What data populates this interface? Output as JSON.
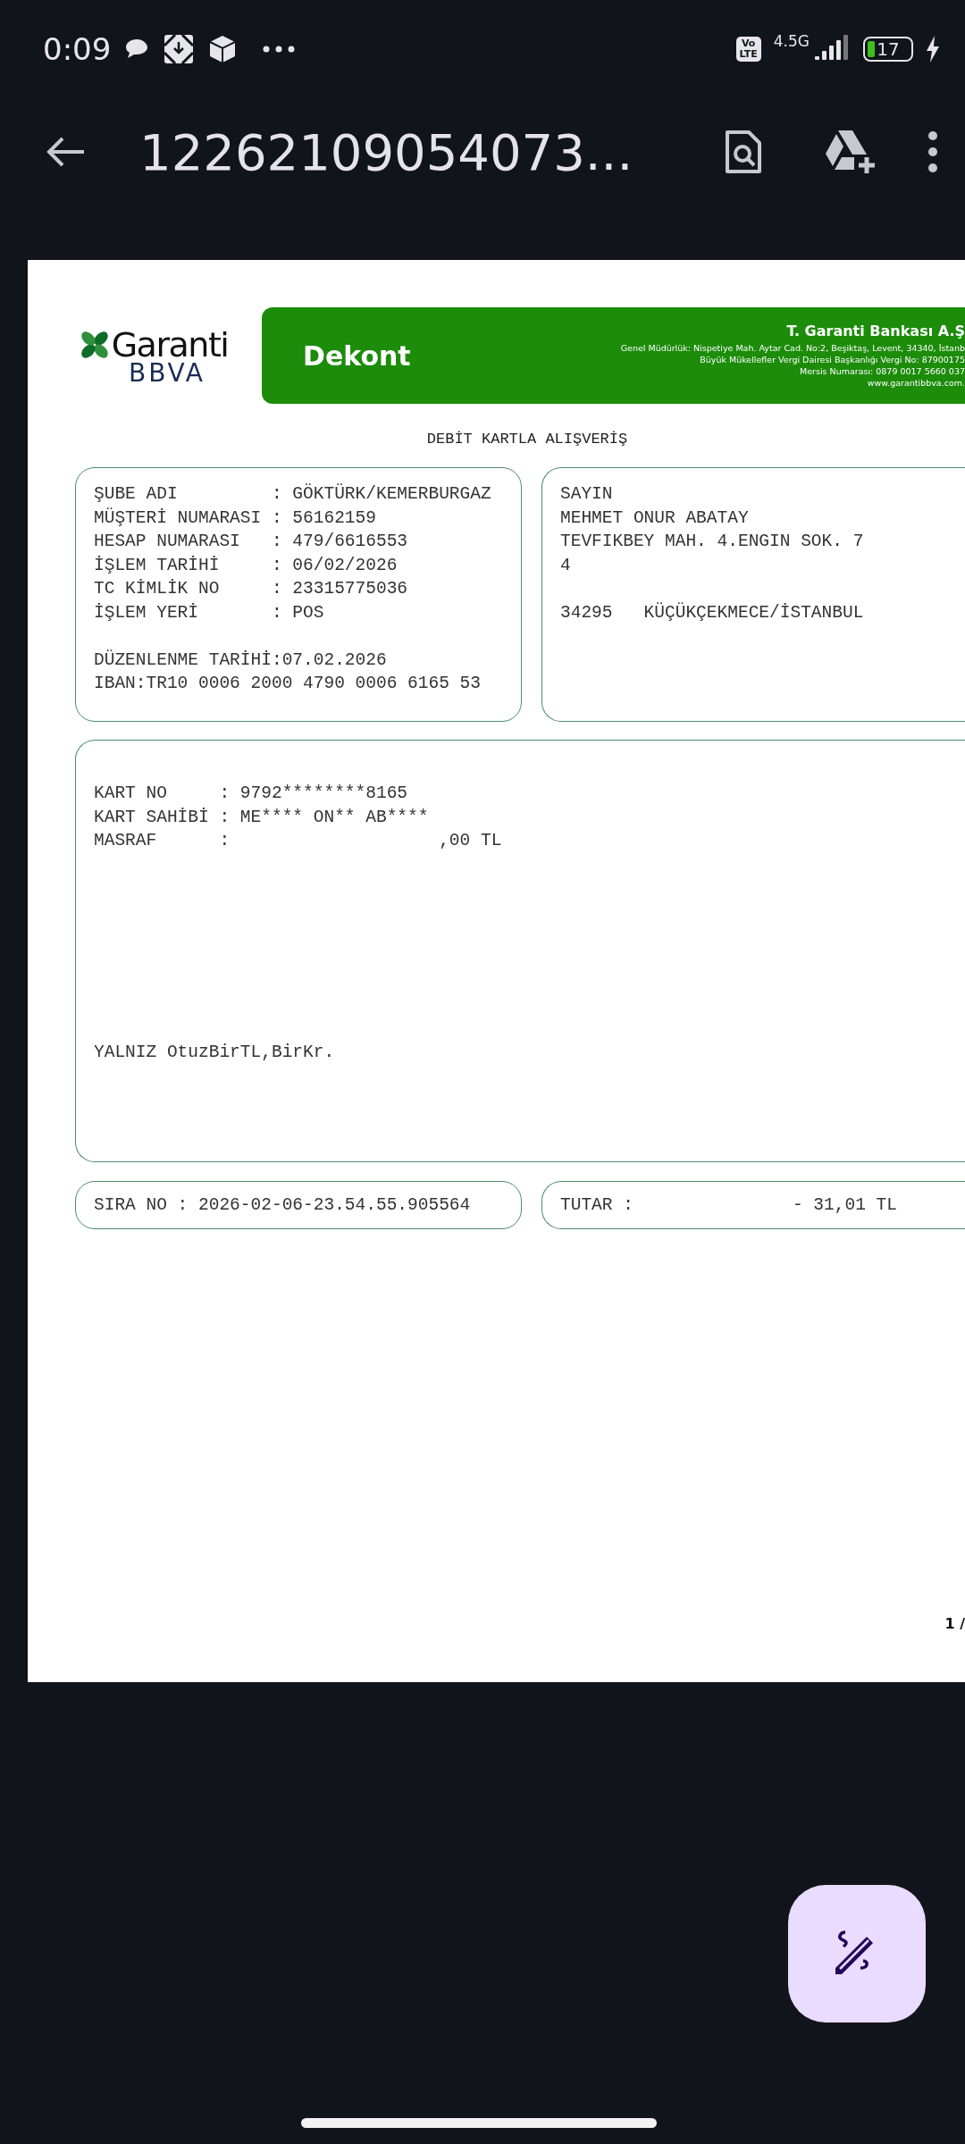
{
  "status_bar": {
    "time": "0:09",
    "volte": [
      "Vo",
      "LTE"
    ],
    "network": "4.5G",
    "battery": "17",
    "charging": true
  },
  "toolbar": {
    "title": "12262109054073..."
  },
  "document": {
    "header": {
      "brand": "Garanti",
      "brand_sub": "BBVA",
      "title": "Dekont",
      "bank_name": "T. Garanti Bankası A.Ş",
      "bank_lines": [
        "Genel Müdürlük: Nispetiye Mah. Aytar Cad. No:2, Beşiktaş, Levent, 34340, İstanb",
        "Büyük Mükellefler Vergi Dairesi Başkanlığı Vergi No: 87900175",
        "Mersis Numarası: 0879 0017 5660 037",
        "www.garantibbva.com."
      ]
    },
    "subject": "DEBİT KARTLA ALIŞVERİŞ",
    "account_box": {
      "fields": [
        "ŞUBE ADI         : GÖKTÜRK/KEMERBURGAZ",
        "MÜŞTERİ NUMARASI : 56162159",
        "HESAP NUMARASI   : 479/6616553",
        "İŞLEM TARİHİ     : 06/02/2026",
        "TC KİMLİK NO     : 23315775036",
        "İŞLEM YERİ       : POS"
      ],
      "footer": [
        "DÜZENLENME TARİHİ:07.02.2026",
        "IBAN:TR10 0006 2000 4790 0006 6165 53"
      ]
    },
    "address_box": {
      "lines": [
        "SAYIN",
        "MEHMET ONUR ABATAY",
        "TEVFIKBEY MAH. 4.ENGIN SOK. 7",
        "4"
      ],
      "city_line": "34295   KÜÇÜKÇEKMECE/İSTANBUL"
    },
    "detail_box": {
      "lines": [
        "KART NO     : 9792********8165",
        "KART SAHİBİ : ME**** ON** AB****",
        "MASRAF      :                    ,00 TL"
      ],
      "amount_words": "YALNIZ OtuzBirTL,BirKr."
    },
    "sequence": "SIRA NO : 2026-02-06-23.54.55.905564",
    "total": {
      "label": "TUTAR :",
      "value": "- 31,01 TL"
    },
    "page_number": "1 /"
  }
}
